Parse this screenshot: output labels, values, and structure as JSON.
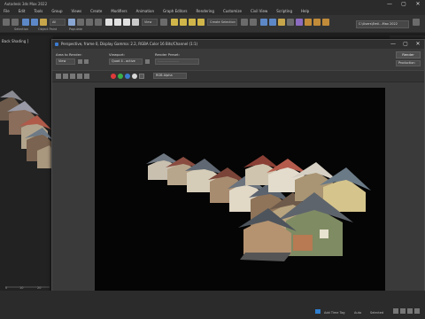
{
  "app": {
    "title": "Autodesk 3ds Max 2022"
  },
  "window_controls": [
    "—",
    "▢",
    "✕"
  ],
  "menu": [
    "File",
    "Edit",
    "Tools",
    "Group",
    "Views",
    "Create",
    "Modifiers",
    "Animation",
    "Graph Editors",
    "Rendering",
    "Customize",
    "Civil View",
    "Scripting",
    "Help"
  ],
  "toolbar": {
    "selection_filter": "All",
    "view_dropdown": "View",
    "named_selection": "Create Selection Se",
    "path": "C:\\Users\\Emil...Max 2022",
    "group_labels": [
      "Selection",
      "Object Paint",
      "Populate"
    ]
  },
  "left_viewport": {
    "label": "[Perspective] [Standard] [Default Shading]",
    "short_label": "Back Shading ]"
  },
  "timeline": {
    "marks": [
      "0",
      "10",
      "20"
    ]
  },
  "render_window": {
    "title": "Perspective, frame 0, Display Gamma: 2.2, RGBA Color 16 Bits/Channel (1:1)",
    "area_to_render_label": "Area to Render:",
    "area_to_render_value": "View",
    "viewport_label": "Viewport:",
    "viewport_value": "Quad 4 - active",
    "render_preset_label": "Render Preset:",
    "render_preset_value": "-------------------",
    "render_button": "Render",
    "production_value": "Production",
    "channel_value": "RGB Alpha",
    "swatch_colors": [
      "#e03a3a",
      "#3bb04a",
      "#3b7bd0",
      "#d8d8d8"
    ]
  },
  "status": {
    "add_time_tag": "Add Time Tag",
    "auto_key": "Auto",
    "selected": "Selected"
  }
}
